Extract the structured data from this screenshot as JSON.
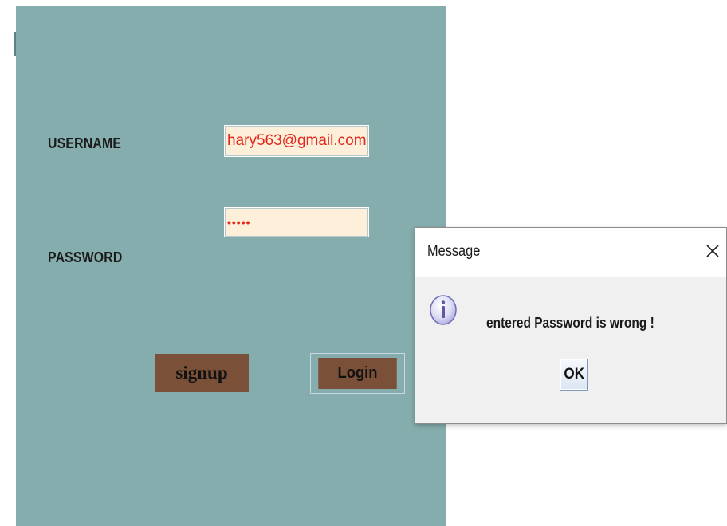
{
  "login_form": {
    "username_label": "USERNAME",
    "username_value": "hary563@gmail.com",
    "password_label": "PASSWORD",
    "password_value": "•••••",
    "signup_label": "signup",
    "login_label": "Login",
    "panel_color": "#86adad",
    "field_background": "#fdefd9",
    "field_text_color": "#e0281c",
    "button_color": "#7a5138"
  },
  "dialog": {
    "title": "Message",
    "close_icon": "close-icon",
    "message_icon": "info-icon",
    "message": "entered Password is wrong !",
    "ok_label": "OK"
  }
}
